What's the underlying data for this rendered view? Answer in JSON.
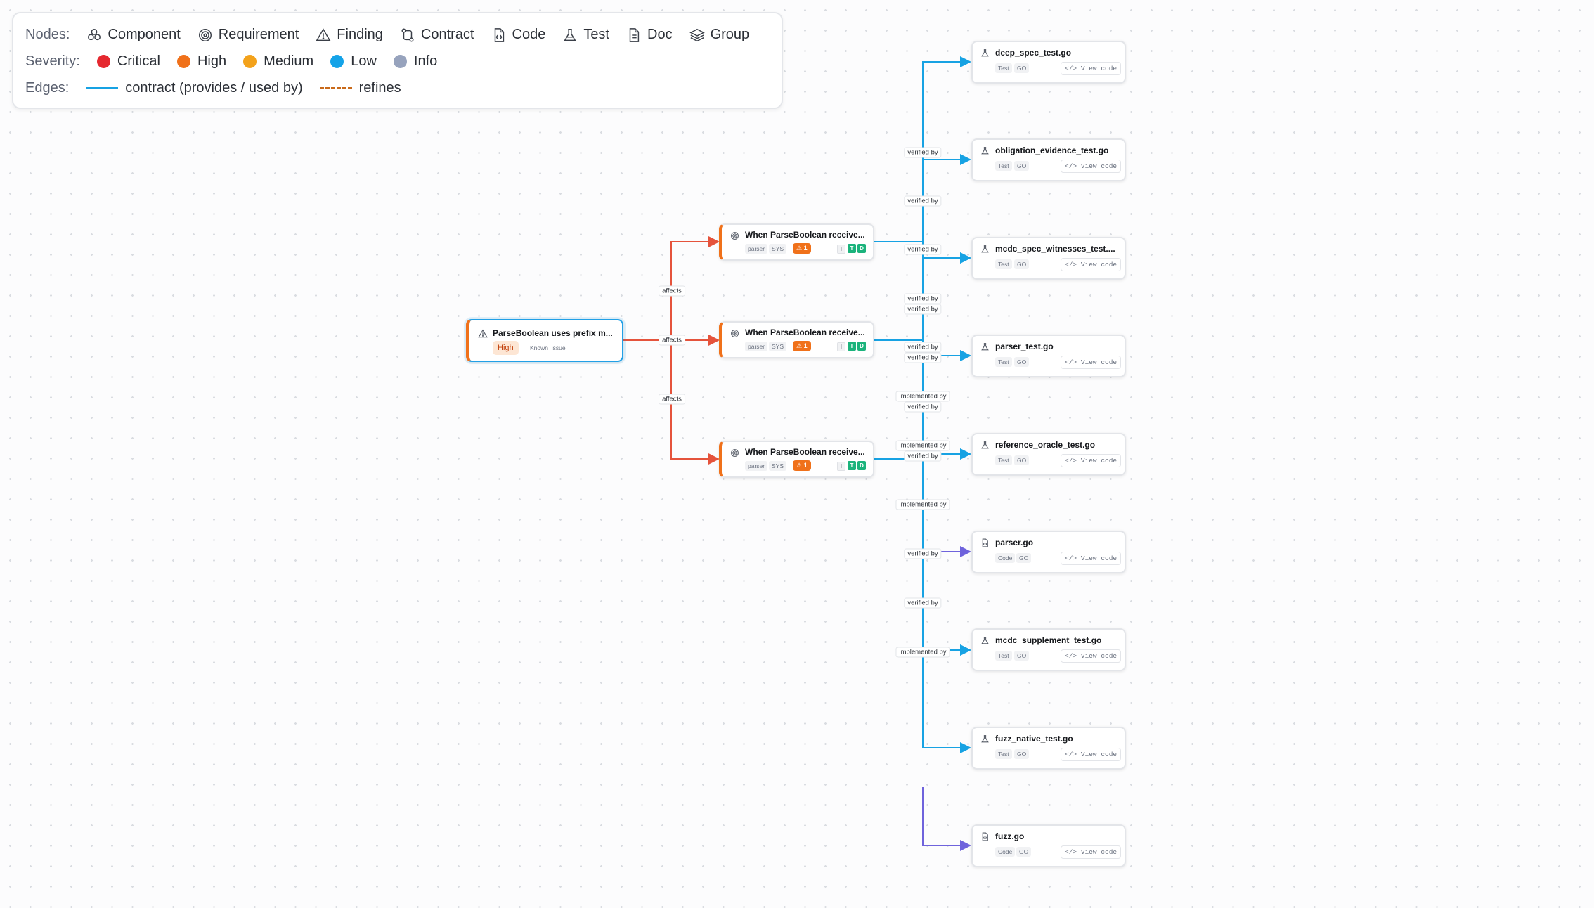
{
  "legend": {
    "nodes_label": "Nodes:",
    "severity_label": "Severity:",
    "edges_label": "Edges:",
    "node_types": [
      {
        "label": "Component",
        "icon": "component-icon"
      },
      {
        "label": "Requirement",
        "icon": "requirement-icon"
      },
      {
        "label": "Finding",
        "icon": "finding-icon"
      },
      {
        "label": "Contract",
        "icon": "contract-icon"
      },
      {
        "label": "Code",
        "icon": "code-icon"
      },
      {
        "label": "Test",
        "icon": "test-icon"
      },
      {
        "label": "Doc",
        "icon": "doc-icon"
      },
      {
        "label": "Group",
        "icon": "group-icon"
      }
    ],
    "severities": [
      {
        "label": "Critical",
        "color": "#e5282f"
      },
      {
        "label": "High",
        "color": "#f0711a"
      },
      {
        "label": "Medium",
        "color": "#f3a21b"
      },
      {
        "label": "Low",
        "color": "#14a3e8"
      },
      {
        "label": "Info",
        "color": "#97a3bd"
      }
    ],
    "edge_types": [
      {
        "label": "contract (provides / used by)",
        "color": "#17a2e3",
        "style": "solid"
      },
      {
        "label": "refines",
        "color": "#c96a1a",
        "style": "dashed"
      }
    ]
  },
  "finding": {
    "title": "ParseBoolean uses prefix m...",
    "severity": "High",
    "tag": "Known_issue",
    "icon": "finding-icon"
  },
  "requirements": [
    {
      "title": "When ParseBoolean receive...",
      "component": "parser",
      "level": "SYS",
      "findings": "1",
      "badges": [
        "I",
        "T",
        "D"
      ]
    },
    {
      "title": "When ParseBoolean receive...",
      "component": "parser",
      "level": "SYS",
      "findings": "1",
      "badges": [
        "I",
        "T",
        "D"
      ]
    },
    {
      "title": "When ParseBoolean receive...",
      "component": "parser",
      "level": "SYS",
      "findings": "1",
      "badges": [
        "I",
        "T",
        "D"
      ]
    }
  ],
  "artifacts": [
    {
      "name": "deep_spec_test.go",
      "kind": "Test",
      "lang": "GO",
      "action": "View code",
      "icon": "test-icon"
    },
    {
      "name": "obligation_evidence_test.go",
      "kind": "Test",
      "lang": "GO",
      "action": "View code",
      "icon": "test-icon"
    },
    {
      "name": "mcdc_spec_witnesses_test....",
      "kind": "Test",
      "lang": "GO",
      "action": "View code",
      "icon": "test-icon"
    },
    {
      "name": "parser_test.go",
      "kind": "Test",
      "lang": "GO",
      "action": "View code",
      "icon": "test-icon"
    },
    {
      "name": "reference_oracle_test.go",
      "kind": "Test",
      "lang": "GO",
      "action": "View code",
      "icon": "test-icon"
    },
    {
      "name": "parser.go",
      "kind": "Code",
      "lang": "GO",
      "action": "View code",
      "icon": "code-icon"
    },
    {
      "name": "mcdc_supplement_test.go",
      "kind": "Test",
      "lang": "GO",
      "action": "View code",
      "icon": "test-icon"
    },
    {
      "name": "fuzz_native_test.go",
      "kind": "Test",
      "lang": "GO",
      "action": "View code",
      "icon": "test-icon"
    },
    {
      "name": "fuzz.go",
      "kind": "Code",
      "lang": "GO",
      "action": "View code",
      "icon": "code-icon"
    }
  ],
  "edge_labels": {
    "affects": "affects",
    "verified_by": "verified by",
    "implemented_by": "implemented by"
  },
  "colors": {
    "affects_edge": "#e5533c",
    "contract_edge": "#17a2e3",
    "code_edge": "#6f63dc",
    "selected_border": "#22a0e6"
  }
}
